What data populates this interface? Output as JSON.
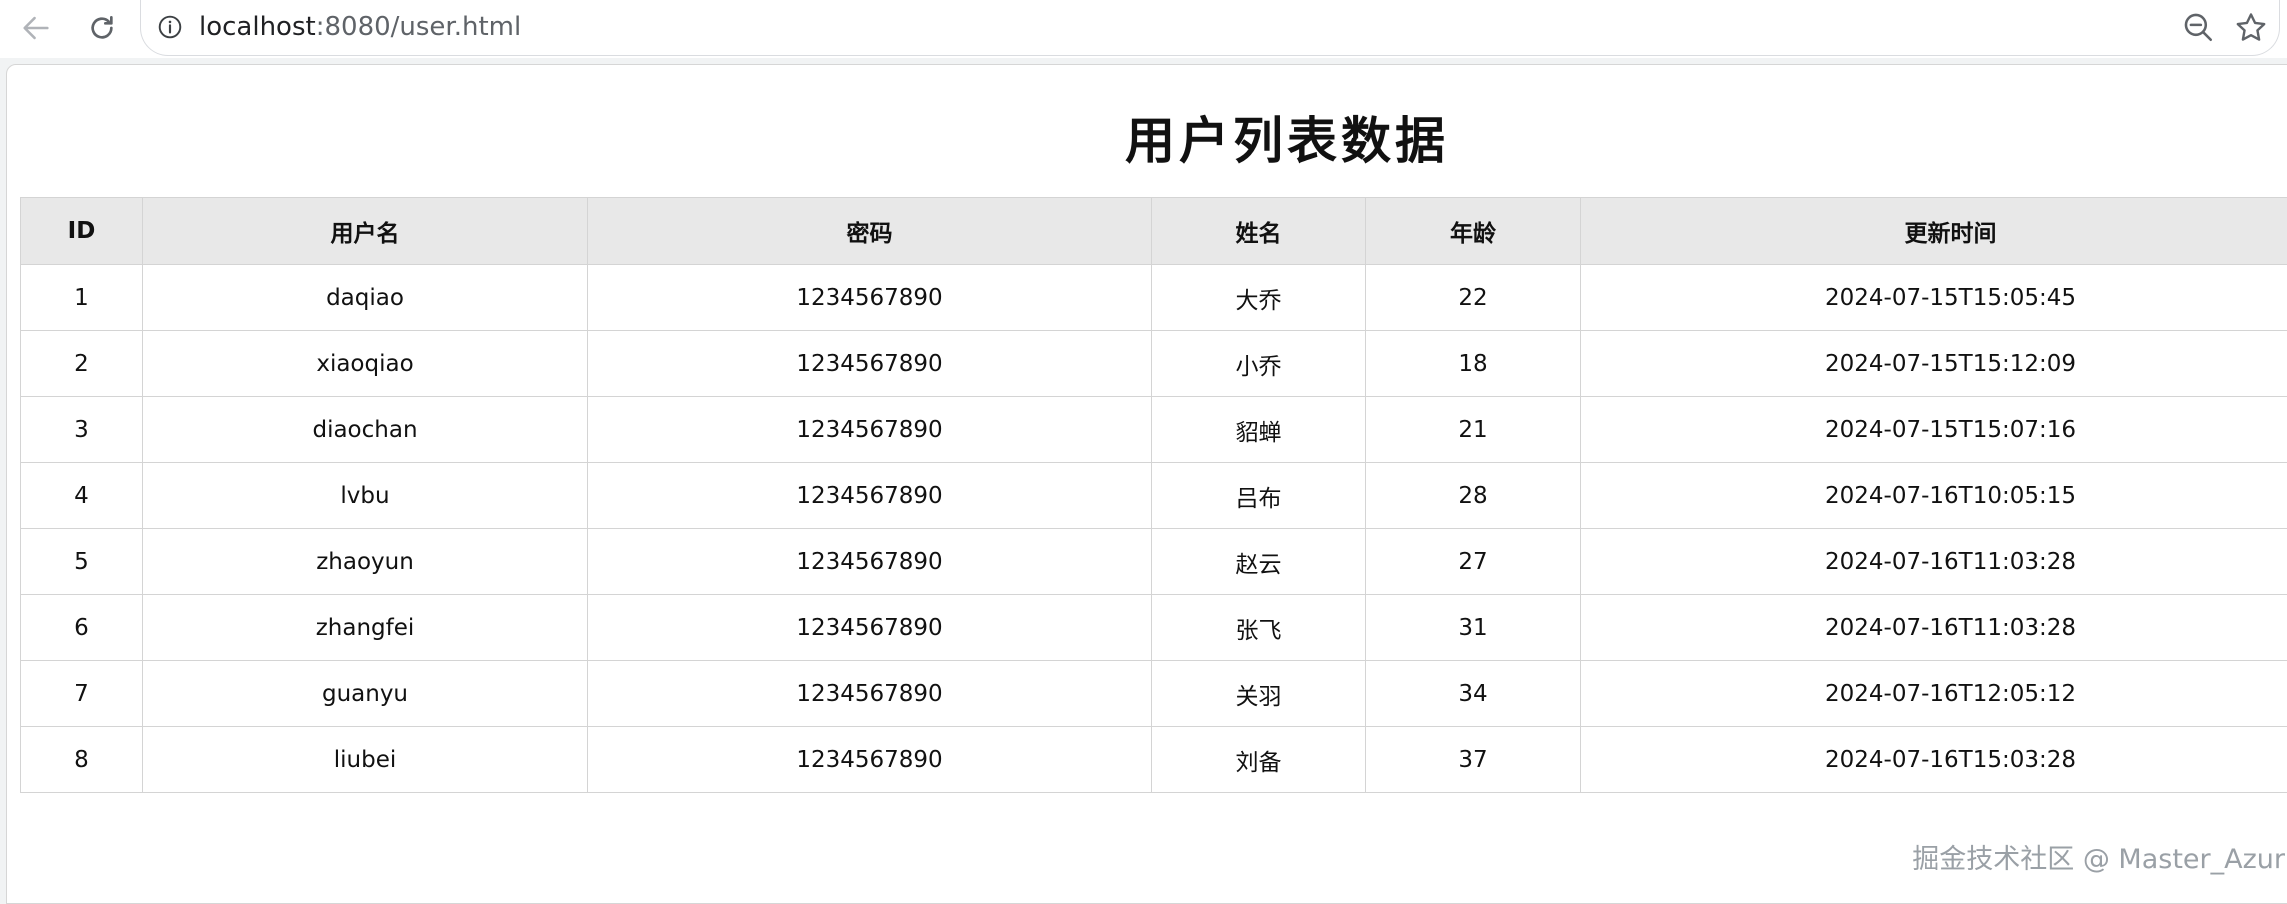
{
  "browser": {
    "url_host": "localhost",
    "url_rest": ":8080/user.html",
    "icons": {
      "back": "arrow-left-icon",
      "reload": "reload-icon",
      "info": "info-icon",
      "zoom": "zoom-out-icon",
      "bookmark": "star-icon"
    }
  },
  "page": {
    "title": "用户列表数据",
    "watermark": "掘金技术社区 @ Master_Azur"
  },
  "table": {
    "headers": [
      "ID",
      "用户名",
      "密码",
      "姓名",
      "年龄",
      "更新时间"
    ],
    "rows": [
      [
        "1",
        "daqiao",
        "1234567890",
        "大乔",
        "22",
        "2024-07-15T15:05:45"
      ],
      [
        "2",
        "xiaoqiao",
        "1234567890",
        "小乔",
        "18",
        "2024-07-15T15:12:09"
      ],
      [
        "3",
        "diaochan",
        "1234567890",
        "貂蝉",
        "21",
        "2024-07-15T15:07:16"
      ],
      [
        "4",
        "lvbu",
        "1234567890",
        "吕布",
        "28",
        "2024-07-16T10:05:15"
      ],
      [
        "5",
        "zhaoyun",
        "1234567890",
        "赵云",
        "27",
        "2024-07-16T11:03:28"
      ],
      [
        "6",
        "zhangfei",
        "1234567890",
        "张飞",
        "31",
        "2024-07-16T11:03:28"
      ],
      [
        "7",
        "guanyu",
        "1234567890",
        "关羽",
        "34",
        "2024-07-16T12:05:12"
      ],
      [
        "8",
        "liubei",
        "1234567890",
        "刘备",
        "37",
        "2024-07-16T15:03:28"
      ]
    ]
  }
}
